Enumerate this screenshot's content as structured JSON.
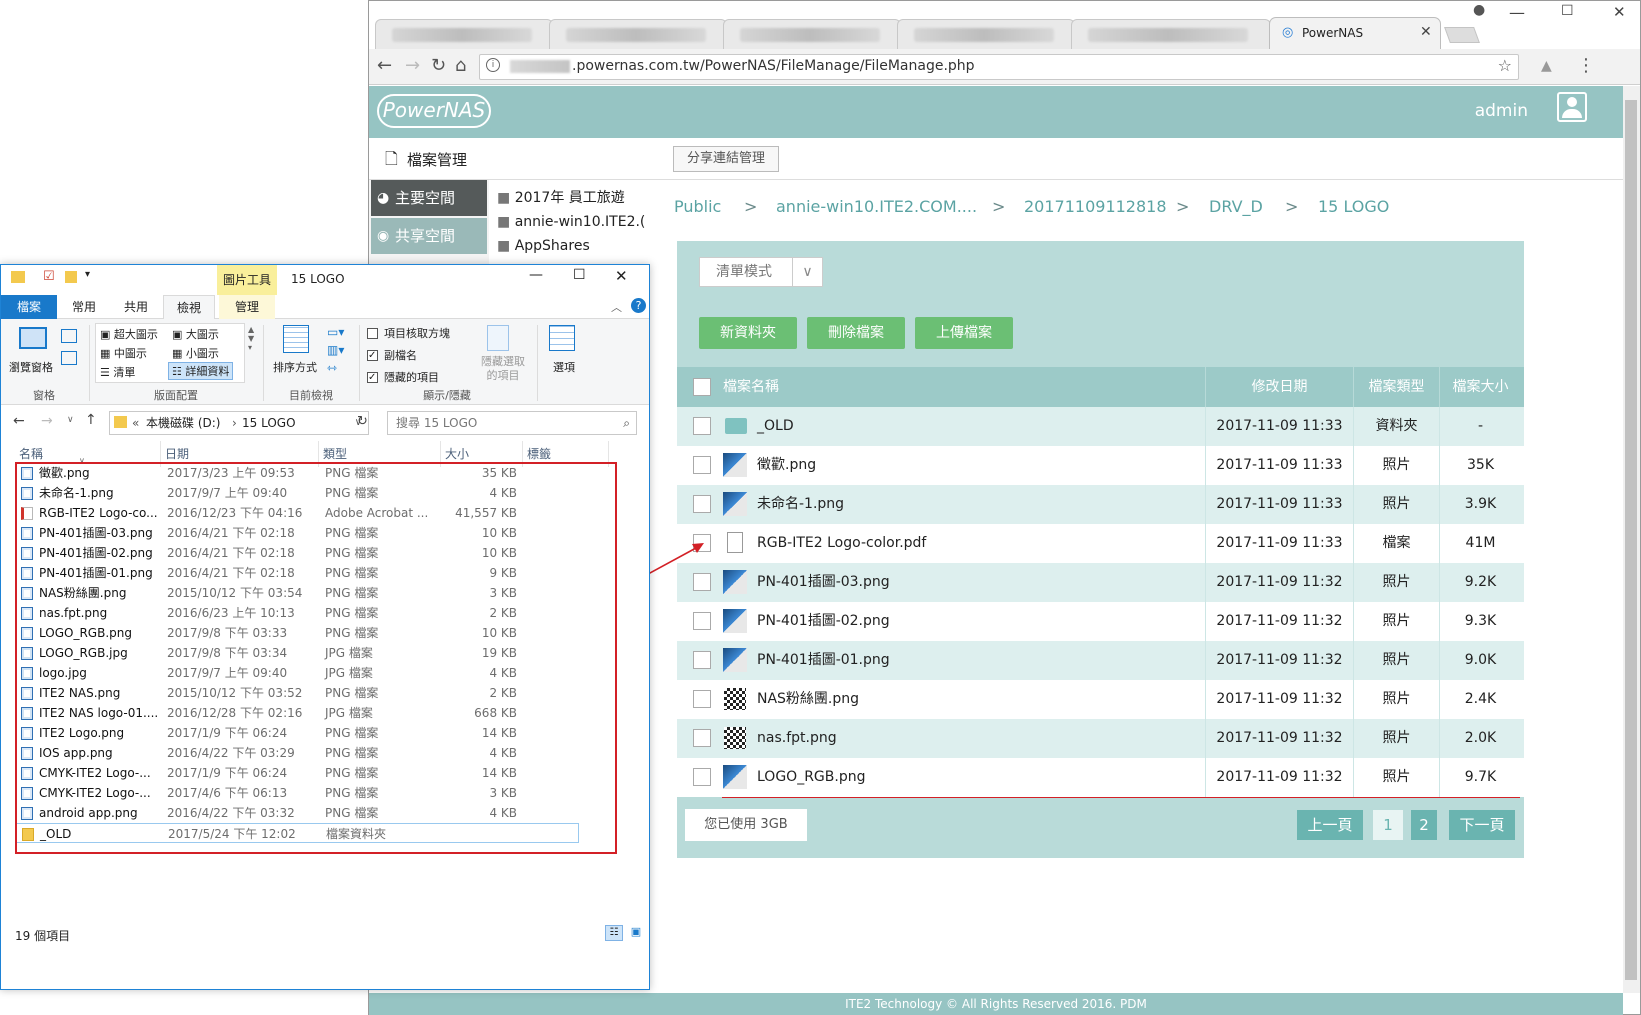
{
  "browser": {
    "active_tab_title": "PowerNAS",
    "url_prefix": "i",
    "url": ".powernas.com.tw/PowerNAS/FileManage/FileManage.php"
  },
  "nas": {
    "logo_text": "PowerNAS",
    "user": "admin",
    "file_manage_label": "檔案管理",
    "share_link_button": "分享連結管理",
    "sidebar": [
      "主要空間",
      "共享空間"
    ],
    "folders": [
      "2017年 員工旅遊",
      "annie-win10.ITE2.(",
      "AppShares"
    ],
    "breadcrumb": [
      "Public",
      "annie-win10.ITE2.COM....",
      "20171109112818",
      "DRV_D",
      "15 LOGO"
    ],
    "breadcrumb_sep": ">",
    "view_mode": "清單模式",
    "buttons": {
      "new_folder": "新資料夾",
      "delete": "刪除檔案",
      "upload": "上傳檔案"
    },
    "columns": {
      "name": "檔案名稱",
      "modified": "修改日期",
      "type": "檔案類型",
      "size": "檔案大小"
    },
    "rows": [
      {
        "name": "_OLD",
        "date": "2017-11-09 11:33",
        "type": "資料夾",
        "size": "-",
        "icon": "folder-icon"
      },
      {
        "name": "徵歡.png",
        "date": "2017-11-09 11:33",
        "type": "照片",
        "size": "35K",
        "icon": "image-thumb"
      },
      {
        "name": "未命名-1.png",
        "date": "2017-11-09 11:33",
        "type": "照片",
        "size": "3.9K",
        "icon": "image-thumb"
      },
      {
        "name": "RGB-ITE2 Logo-color.pdf",
        "date": "2017-11-09 11:33",
        "type": "檔案",
        "size": "41M",
        "icon": "document-icon"
      },
      {
        "name": "PN-401插圖-03.png",
        "date": "2017-11-09 11:32",
        "type": "照片",
        "size": "9.2K",
        "icon": "image-thumb"
      },
      {
        "name": "PN-401插圖-02.png",
        "date": "2017-11-09 11:32",
        "type": "照片",
        "size": "9.3K",
        "icon": "image-thumb"
      },
      {
        "name": "PN-401插圖-01.png",
        "date": "2017-11-09 11:32",
        "type": "照片",
        "size": "9.0K",
        "icon": "image-thumb"
      },
      {
        "name": "NAS粉絲團.png",
        "date": "2017-11-09 11:32",
        "type": "照片",
        "size": "2.4K",
        "icon": "qr-thumb"
      },
      {
        "name": "nas.fpt.png",
        "date": "2017-11-09 11:32",
        "type": "照片",
        "size": "2.0K",
        "icon": "qr-thumb"
      },
      {
        "name": "LOGO_RGB.png",
        "date": "2017-11-09 11:32",
        "type": "照片",
        "size": "9.7K",
        "icon": "image-thumb"
      }
    ],
    "usage": "您已使用 3GB",
    "pagination": {
      "prev": "上一頁",
      "pages": [
        "1",
        "2"
      ],
      "next": "下一頁"
    },
    "footer": "ITE2 Technology © All Rights Reserved 2016. PDM",
    "colors": {
      "header": "#96c4c3",
      "accent": "#5ba3a3",
      "button": "#6bbf74",
      "highlight": "#d32026"
    }
  },
  "explorer": {
    "title": "15 LOGO",
    "tool_tab": "圖片工具",
    "ribbon_tabs": [
      "檔案",
      "常用",
      "共用",
      "檢視",
      "管理"
    ],
    "ribbon": {
      "pane_btn": "瀏覽窗格",
      "pane_group": "窗格",
      "layout_items": [
        "超大圖示",
        "大圖示",
        "中圖示",
        "小圖示",
        "清單",
        "詳細資料"
      ],
      "layout_group": "版面配置",
      "sort_btn": "排序方式",
      "current_view_group": "目前檢視",
      "checks": [
        {
          "label": "項目核取方塊",
          "checked": false
        },
        {
          "label": "副檔名",
          "checked": true
        },
        {
          "label": "隱藏的項目",
          "checked": true
        }
      ],
      "hide_selected": "隱藏選取的項目",
      "show_hide_group": "顯示/隱藏",
      "options_btn": "選項"
    },
    "path": [
      "本機磁碟 (D:)",
      "15 LOGO"
    ],
    "search_placeholder": "搜尋 15 LOGO",
    "columns": {
      "name": "名稱",
      "date": "日期",
      "type": "類型",
      "size": "大小",
      "tags": "標籤"
    },
    "files": [
      {
        "name": "徵歡.png",
        "date": "2017/3/23 上午 09:53",
        "type": "PNG 檔案",
        "size": "35 KB",
        "kind": "png"
      },
      {
        "name": "未命名-1.png",
        "date": "2017/9/7 上午 09:40",
        "type": "PNG 檔案",
        "size": "4 KB",
        "kind": "png"
      },
      {
        "name": "RGB-ITE2 Logo-co...",
        "date": "2016/12/23 下午 04:16",
        "type": "Adobe Acrobat ...",
        "size": "41,557 KB",
        "kind": "pdf"
      },
      {
        "name": "PN-401插圖-03.png",
        "date": "2016/4/21 下午 02:18",
        "type": "PNG 檔案",
        "size": "10 KB",
        "kind": "png"
      },
      {
        "name": "PN-401插圖-02.png",
        "date": "2016/4/21 下午 02:18",
        "type": "PNG 檔案",
        "size": "10 KB",
        "kind": "png"
      },
      {
        "name": "PN-401插圖-01.png",
        "date": "2016/4/21 下午 02:18",
        "type": "PNG 檔案",
        "size": "9 KB",
        "kind": "png"
      },
      {
        "name": "NAS粉絲團.png",
        "date": "2015/10/12 下午 03:54",
        "type": "PNG 檔案",
        "size": "3 KB",
        "kind": "png"
      },
      {
        "name": "nas.fpt.png",
        "date": "2016/6/23 上午 10:13",
        "type": "PNG 檔案",
        "size": "2 KB",
        "kind": "png"
      },
      {
        "name": "LOGO_RGB.png",
        "date": "2017/9/8 下午 03:33",
        "type": "PNG 檔案",
        "size": "10 KB",
        "kind": "png"
      },
      {
        "name": "LOGO_RGB.jpg",
        "date": "2017/9/8 下午 03:34",
        "type": "JPG 檔案",
        "size": "19 KB",
        "kind": "jpg"
      },
      {
        "name": "logo.jpg",
        "date": "2017/9/7 上午 09:40",
        "type": "JPG 檔案",
        "size": "4 KB",
        "kind": "jpg"
      },
      {
        "name": "ITE2 NAS.png",
        "date": "2015/10/12 下午 03:52",
        "type": "PNG 檔案",
        "size": "2 KB",
        "kind": "png"
      },
      {
        "name": "ITE2 NAS logo-01....",
        "date": "2016/12/28 下午 02:16",
        "type": "JPG 檔案",
        "size": "668 KB",
        "kind": "jpg"
      },
      {
        "name": "ITE2 Logo.png",
        "date": "2017/1/9 下午 06:24",
        "type": "PNG 檔案",
        "size": "14 KB",
        "kind": "png"
      },
      {
        "name": "IOS app.png",
        "date": "2016/4/22 下午 03:29",
        "type": "PNG 檔案",
        "size": "4 KB",
        "kind": "png"
      },
      {
        "name": "CMYK-ITE2 Logo-...",
        "date": "2017/1/9 下午 06:24",
        "type": "PNG 檔案",
        "size": "14 KB",
        "kind": "png"
      },
      {
        "name": "CMYK-ITE2 Logo-...",
        "date": "2017/4/6 下午 06:13",
        "type": "PNG 檔案",
        "size": "3 KB",
        "kind": "png"
      },
      {
        "name": "android app.png",
        "date": "2016/4/22 下午 03:32",
        "type": "PNG 檔案",
        "size": "4 KB",
        "kind": "png"
      },
      {
        "name": "_OLD",
        "date": "2017/5/24 下午 12:02",
        "type": "檔案資料夾",
        "size": "",
        "kind": "folder"
      }
    ],
    "status": "19 個項目"
  }
}
